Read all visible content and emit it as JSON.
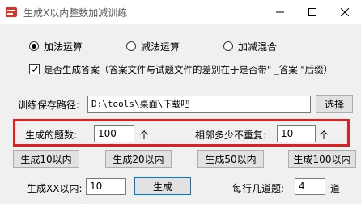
{
  "window": {
    "title": "生成X以内整数加减训练",
    "icons": {
      "app": "app-icon",
      "minimize": "minimize-icon",
      "maximize": "maximize-icon",
      "close": "close-icon"
    }
  },
  "options": {
    "radio_add": "加法运算",
    "radio_sub": "减法运算",
    "radio_mixed": "加减混合",
    "selected": "加法运算",
    "answer_checkbox": "是否生成答案（答案文件与试题文件的差别在于是否带\" _答案 \"后缀）",
    "answer_checked": true
  },
  "path": {
    "label": "训练保存路径:",
    "value": "D:\\tools\\桌面\\下载吧",
    "choose_button": "选择"
  },
  "counts": {
    "count_label": "生成的题数:",
    "count_value": "100",
    "count_unit": "个",
    "no_repeat_label": "相邻多少不重复:",
    "no_repeat_value": "10",
    "no_repeat_unit": "个"
  },
  "presets": {
    "btn10": "生成10以内",
    "btn20": "生成20以内",
    "btn50": "生成50以内",
    "btn100": "生成100以内"
  },
  "custom": {
    "label": "生成XX以内:",
    "value": "10",
    "generate_button": "生成",
    "per_row_label": "每行几道题:",
    "per_row_value": "4",
    "per_row_unit": "道"
  },
  "colors": {
    "highlight": "#e02020",
    "accent": "#0078d7"
  }
}
